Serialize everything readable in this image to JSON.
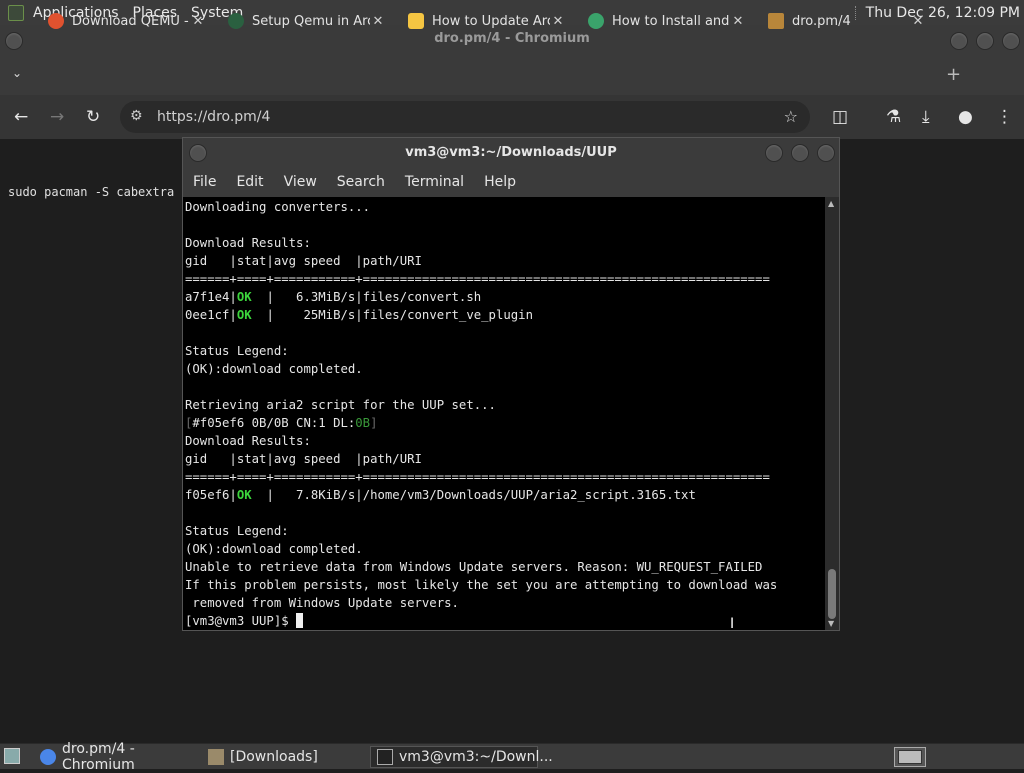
{
  "top_panel": {
    "menus": [
      "Applications",
      "Places",
      "System"
    ],
    "clock": "Thu Dec 26, 12:09 PM"
  },
  "browser": {
    "window_title": "dro.pm/4 - Chromium",
    "tabs": [
      {
        "label": "Download QEMU - ",
        "favicon_color": "#e0522f"
      },
      {
        "label": "Setup Qemu in Arc",
        "favicon_color": "#2a6040"
      },
      {
        "label": "How to Update Arc",
        "favicon_color": "#f5c542"
      },
      {
        "label": "How to Install and",
        "favicon_color": "#3aa36b"
      },
      {
        "label": "dro.pm/4",
        "favicon_color": "#b8863a"
      }
    ],
    "url": "https://dro.pm/4",
    "page_text": "sudo pacman -S cabextra"
  },
  "terminal": {
    "title": "vm3@vm3:~/Downloads/UUP",
    "menu": [
      "File",
      "Edit",
      "View",
      "Search",
      "Terminal",
      "Help"
    ],
    "lines": {
      "l1": "Downloading converters...",
      "l2": "",
      "l3": "Download Results:",
      "l4": "gid   |stat|avg speed  |path/URI",
      "l5": "======+====+===========+=======================================================",
      "l6a": "a7f1e4|",
      "l6b": "OK",
      "l6c": "  |   6.3MiB/s|files/convert.sh",
      "l7a": "0ee1cf|",
      "l7b": "OK",
      "l7c": "  |    25MiB/s|files/convert_ve_plugin",
      "l8": "",
      "l9": "Status Legend:",
      "l10": "(OK):download completed.",
      "l11": "",
      "l12": "Retrieving aria2 script for the UUP set...",
      "l13a": "[",
      "l13b": "#f05ef6 0B/0B CN:1 DL:",
      "l13c": "0B",
      "l13d": "]",
      "l14": "Download Results:",
      "l15": "gid   |stat|avg speed  |path/URI",
      "l16": "======+====+===========+=======================================================",
      "l17a": "f05ef6|",
      "l17b": "OK",
      "l17c": "  |   7.8KiB/s|/home/vm3/Downloads/UUP/aria2_script.3165.txt",
      "l18": "",
      "l19": "Status Legend:",
      "l20": "(OK):download completed.",
      "l21": "Unable to retrieve data from Windows Update servers. Reason: WU_REQUEST_FAILED",
      "l22": "If this problem persists, most likely the set you are attempting to download was",
      "l23": " removed from Windows Update servers.",
      "prompt": "[vm3@vm3 UUP]$ "
    }
  },
  "taskbar": {
    "items": [
      "dro.pm/4 - Chromium",
      "[Downloads]",
      "vm3@vm3:~/Downl..."
    ]
  }
}
